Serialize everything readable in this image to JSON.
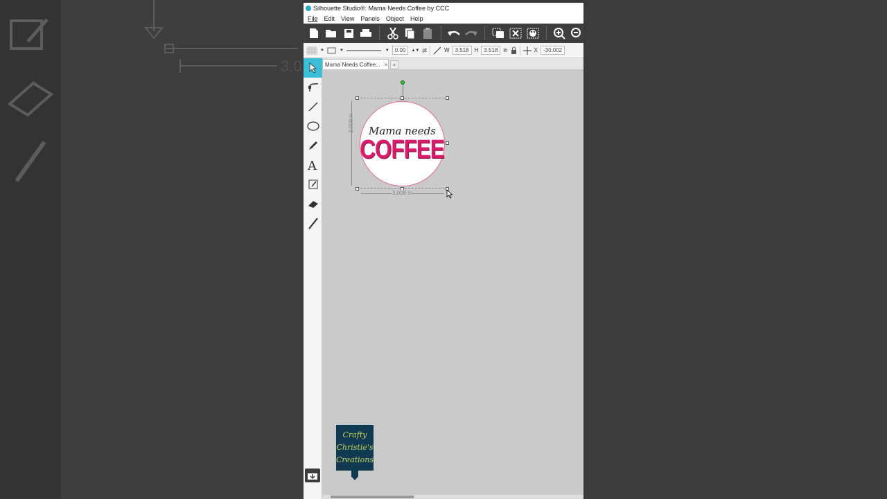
{
  "window": {
    "title": "Silhouette Studio®: Mama Needs Coffee by CCC"
  },
  "menu": {
    "items": [
      "File",
      "Edit",
      "View",
      "Panels",
      "Object",
      "Help"
    ]
  },
  "properties": {
    "line_width": "0.00",
    "line_unit": "pt",
    "width_label": "W",
    "width_value": "3.518",
    "height_label": "H",
    "height_value": "3.518",
    "size_unit": "in",
    "x_label": "X",
    "x_value": "-30.002"
  },
  "tabs": {
    "doc_tab_label": "Mama Needs Coffee...",
    "close_glyph": "×",
    "new_tab_glyph": "+"
  },
  "design": {
    "line1": "Mama needs",
    "line2": "COFFEE",
    "height_dim": "3.008 in",
    "width_dim": "3.008 in"
  },
  "brand": {
    "line1": "Crafty",
    "line2": "Christie's",
    "line3": "Creations"
  },
  "colors": {
    "accent": "#3bbfd8",
    "coffee": "#d81b6a",
    "brand_bg": "#0f3a52",
    "brand_text": "#c8d65a"
  }
}
